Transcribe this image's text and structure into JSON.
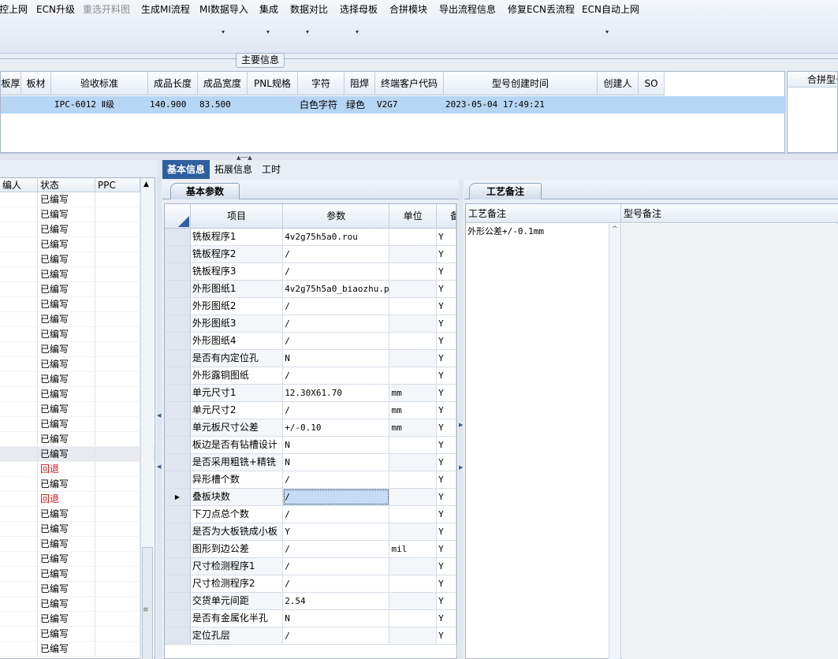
{
  "toolbar": {
    "items": [
      "控上网",
      "ECN升级",
      "重选开料图",
      "生成MI流程",
      "MI数据导入",
      "集成",
      "数据对比",
      "选择母板",
      "合拼模块",
      "导出流程信息",
      "修复ECN丢流程",
      "ECN自动上网"
    ],
    "disabled_item": "重选开料图",
    "dropdown_arrow_glyph": "▾"
  },
  "main_info": {
    "group_title": "主要信息",
    "columns": [
      "板厚",
      "板材",
      "验收标准",
      "成品长度",
      "成品宽度",
      "PNL规格",
      "字符",
      "阻焊",
      "终端客户代码",
      "型号创建时间",
      "创建人",
      "SO"
    ],
    "row": [
      "",
      "",
      "IPC-6012 Ⅱ级",
      "140.900",
      "83.500",
      "",
      "白色字符",
      "绿色",
      "V2G7",
      "2023-05-04 17:49:21",
      "",
      ""
    ],
    "side_panel_title": "合拼型号"
  },
  "left_list": {
    "columns": [
      "编人",
      "状态",
      "PPC"
    ],
    "statuses": [
      "已编写",
      "已编写",
      "已编写",
      "已编写",
      "已编写",
      "已编写",
      "已编写",
      "已编写",
      "已编写",
      "已编写",
      "已编写",
      "已编写",
      "已编写",
      "已编写",
      "已编写",
      "已编写",
      "已编写",
      "已编写",
      "回退",
      "已编写",
      "回退",
      "已编写",
      "已编写",
      "已编写",
      "已编写",
      "已编写",
      "已编写",
      "已编写",
      "已编写",
      "已编写",
      "已编写"
    ],
    "selected_index": 17,
    "scroll_up_glyph": "▲",
    "scroll_grip_glyph": "≡",
    "status_colors": {
      "回退": "#cc1111"
    }
  },
  "tabs": [
    "基本信息",
    "拓展信息",
    "工时"
  ],
  "basic_params": {
    "panel_title": "基本参数",
    "columns": [
      "项目",
      "参数",
      "单位",
      "备"
    ],
    "rows": [
      [
        "铣板程序1",
        "4v2g75h5a0.rou",
        "",
        "Y"
      ],
      [
        "铣板程序2",
        "/",
        "",
        "Y"
      ],
      [
        "铣板程序3",
        "/",
        "",
        "Y"
      ],
      [
        "外形图纸1",
        "4v2g75h5a0_biaozhu.pdf",
        "",
        "Y"
      ],
      [
        "外形图纸2",
        "/",
        "",
        "Y"
      ],
      [
        "外形图纸3",
        "/",
        "",
        "Y"
      ],
      [
        "外形图纸4",
        "/",
        "",
        "Y"
      ],
      [
        "是否有内定位孔",
        "N",
        "",
        "Y"
      ],
      [
        "外形露铜图纸",
        "/",
        "",
        "Y"
      ],
      [
        "单元尺寸1",
        "12.30X61.70",
        "mm",
        "Y"
      ],
      [
        "单元尺寸2",
        "/",
        "mm",
        "Y"
      ],
      [
        "单元板尺寸公差",
        "+/-0.10",
        "mm",
        "Y"
      ],
      [
        "板边是否有钻槽设计",
        "N",
        "",
        "Y"
      ],
      [
        "是否采用粗铣+精铣",
        "N",
        "",
        "Y"
      ],
      [
        "异形槽个数",
        "/",
        "",
        "Y"
      ],
      [
        "叠板块数",
        "/",
        "",
        "Y"
      ],
      [
        "下刀点总个数",
        "/",
        "",
        "Y"
      ],
      [
        "是否为大板铣成小板",
        "Y",
        "",
        "Y"
      ],
      [
        "图形到边公差",
        "/",
        "mil",
        "Y"
      ],
      [
        "尺寸检测程序1",
        "/",
        "",
        "Y"
      ],
      [
        "尺寸检测程序2",
        "/",
        "",
        "Y"
      ],
      [
        "交货单元间距",
        "2.54",
        "",
        "Y"
      ],
      [
        "是否有金属化半孔",
        "N",
        "",
        "Y"
      ],
      [
        "定位孔层",
        "/",
        "",
        "Y"
      ]
    ],
    "current_row": 15,
    "current_row_glyph": "▶"
  },
  "process_notes": {
    "panel_title": "工艺备注",
    "col1": "工艺备注",
    "col2": "型号备注",
    "note_text": "外形公差+/-0.1mm",
    "scroll_glyph": "^"
  },
  "splitter_glyphs": {
    "up": "▲",
    "dots": "········",
    "left": "◀",
    "right": "▶"
  }
}
